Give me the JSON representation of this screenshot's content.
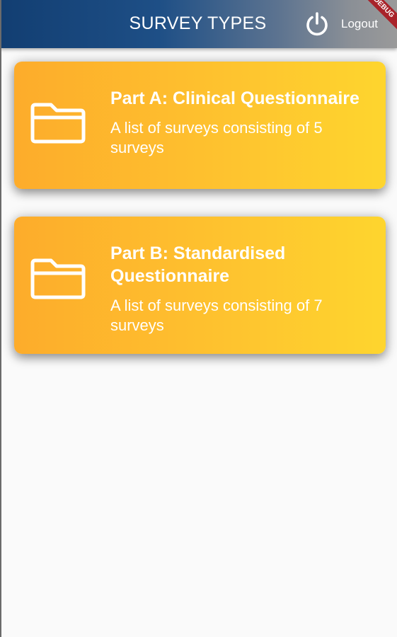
{
  "appbar": {
    "title": "SURVEY TYPES",
    "logout_label": "Logout",
    "logout_icon": "power-icon",
    "debug_banner": "DEBUG"
  },
  "cards": [
    {
      "title": "Part A: Clinical Questionnaire",
      "subtitle": "A list of surveys consisting of 5 surveys",
      "icon": "folder-icon"
    },
    {
      "title": "Part B: Standardised Questionnaire",
      "subtitle": "A list of surveys consisting of 7 surveys",
      "icon": "folder-icon"
    }
  ],
  "colors": {
    "appbar_start": "#123e72",
    "appbar_end": "#9a9a9a",
    "card_start": "#fdac2b",
    "card_end": "#fed52e",
    "background": "#fafafa",
    "debug": "#a8232a"
  }
}
